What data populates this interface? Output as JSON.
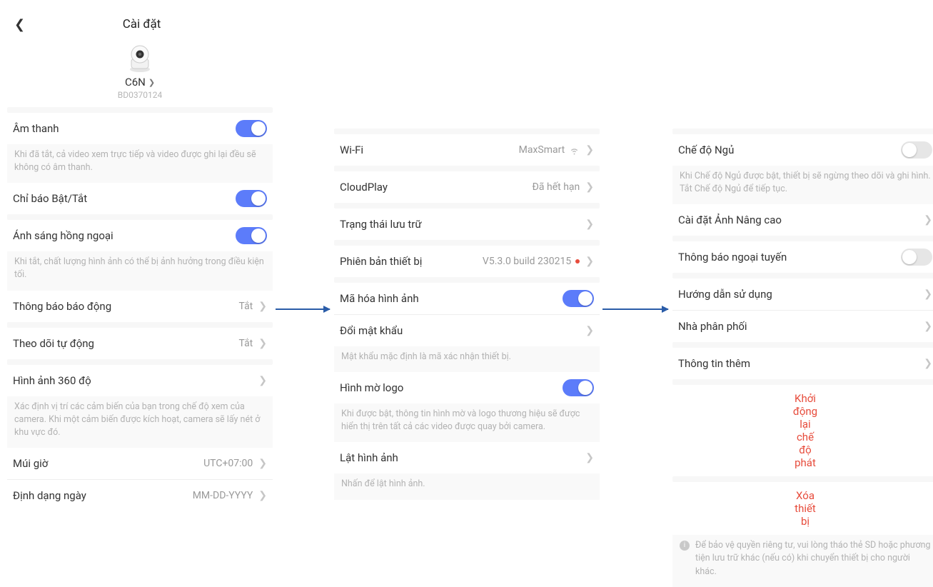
{
  "header": {
    "title": "Cài đặt"
  },
  "device": {
    "name": "C6N",
    "serial": "BD0370124"
  },
  "col1": {
    "audio": {
      "label": "Âm thanh",
      "on": true,
      "desc": "Khi đã tắt, cả video xem trực tiếp và video được ghi lại đều sẽ không có âm thanh."
    },
    "status_light": {
      "label": "Chỉ báo Bật/Tắt",
      "on": true
    },
    "ir": {
      "label": "Ánh sáng hồng ngoại",
      "on": true,
      "desc": "Khi tắt, chất lượng hình ảnh có thể bị ảnh hưởng trong điều kiện tối."
    },
    "alarm": {
      "label": "Thông báo báo động",
      "value": "Tắt"
    },
    "auto_track": {
      "label": "Theo dõi tự động",
      "value": "Tắt"
    },
    "pano": {
      "label": "Hình ảnh 360 độ",
      "desc": "Xác định vị trí các cảm biến của bạn trong chế độ xem của camera. Khi một cảm biến được kích hoạt, camera sẽ lấy nét ở khu vực đó."
    },
    "tz": {
      "label": "Múi giờ",
      "value": "UTC+07:00"
    },
    "date_fmt": {
      "label": "Định dạng ngày",
      "value": "MM-DD-YYYY"
    }
  },
  "col2": {
    "wifi": {
      "label": "Wi-Fi",
      "value": "MaxSmart"
    },
    "cloudplay": {
      "label": "CloudPlay",
      "value": "Đã hết hạn"
    },
    "storage": {
      "label": "Trạng thái lưu trữ"
    },
    "firmware": {
      "label": "Phiên bản thiết bị",
      "value": "V5.3.0 build 230215"
    },
    "encrypt": {
      "label": "Mã hóa hình ảnh",
      "on": true
    },
    "change_pwd": {
      "label": "Đổi mật khẩu",
      "desc": "Mật khẩu mặc định là mã xác nhận thiết bị."
    },
    "watermark": {
      "label": "Hình mờ logo",
      "on": true,
      "desc": "Khi được bật, thông tin hình mờ và logo thương hiệu sẽ được hiển thị trên tất cả các video được quay bởi camera."
    },
    "flip": {
      "label": "Lật hình ảnh",
      "desc": "Nhấn để lật hình ảnh."
    }
  },
  "col3": {
    "sleep": {
      "label": "Chế độ Ngủ",
      "on": false,
      "desc": "Khi Chế độ Ngủ được bật, thiết bị sẽ ngừng theo dõi và ghi hình. Tắt Chế độ Ngủ để tiếp tục."
    },
    "adv_img": {
      "label": "Cài đặt Ảnh Nâng cao"
    },
    "offline": {
      "label": "Thông báo ngoại tuyến",
      "on": false
    },
    "manual": {
      "label": "Hướng dẫn sử dụng"
    },
    "distributor": {
      "label": "Nhà phân phối"
    },
    "more": {
      "label": "Thông tin thêm"
    },
    "restart": {
      "label": "Khởi động lại chế độ phát"
    },
    "delete": {
      "label": "Xóa thiết bị",
      "desc": "Để bảo vệ quyền riêng tư, vui lòng tháo thẻ SD hoặc phương tiện lưu trữ khác (nếu có) khi chuyển thiết bị cho người khác."
    }
  }
}
